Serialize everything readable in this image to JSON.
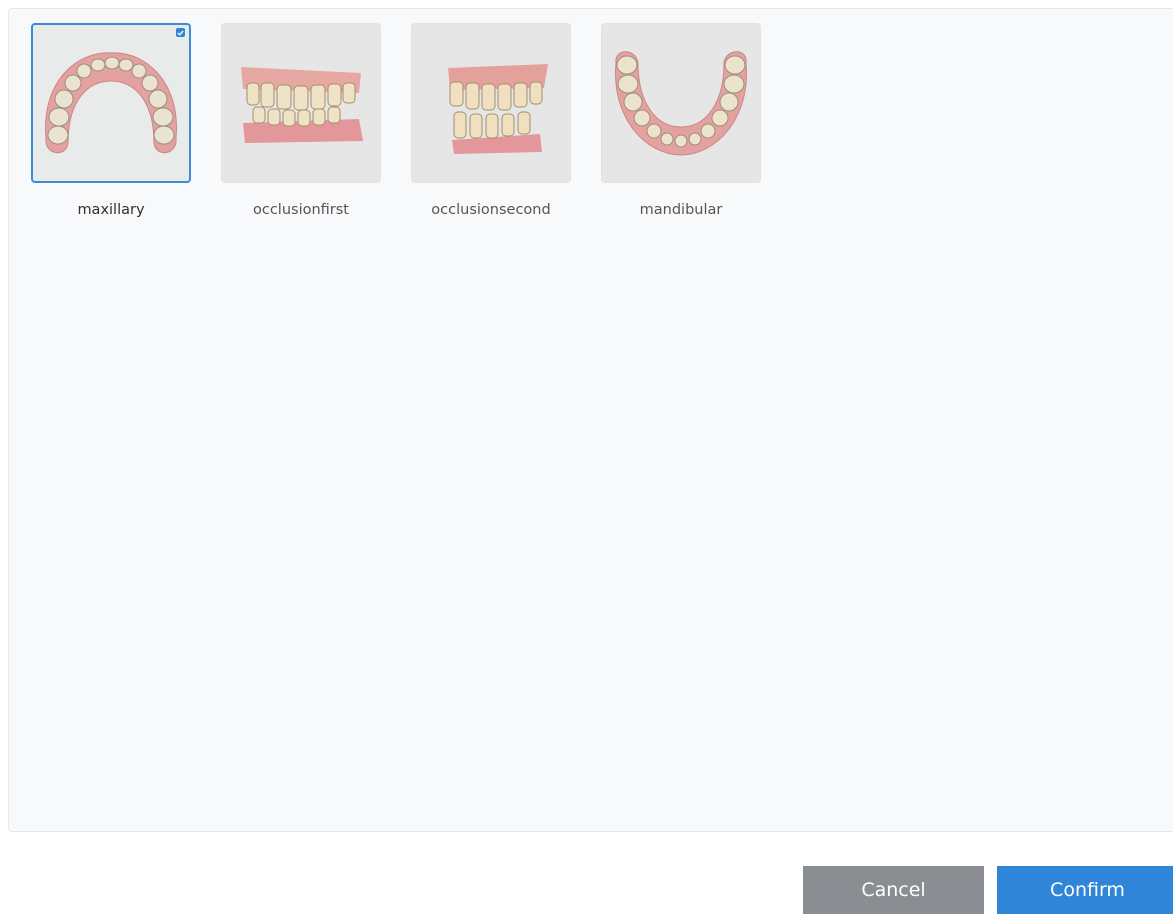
{
  "models": [
    {
      "label": "maxillary",
      "selected": true,
      "icon": "maxillary-arch-icon"
    },
    {
      "label": "occlusionfirst",
      "selected": false,
      "icon": "occlusion-first-icon"
    },
    {
      "label": "occlusionsecond",
      "selected": false,
      "icon": "occlusion-second-icon"
    },
    {
      "label": "mandibular",
      "selected": false,
      "icon": "mandibular-arch-icon"
    }
  ],
  "buttons": {
    "cancel_label": "Cancel",
    "confirm_label": "Confirm"
  },
  "colors": {
    "accent": "#2f86d8",
    "cancel": "#8a8d92",
    "gum": "#e7a0a0",
    "tooth": "#f1e8d4"
  }
}
